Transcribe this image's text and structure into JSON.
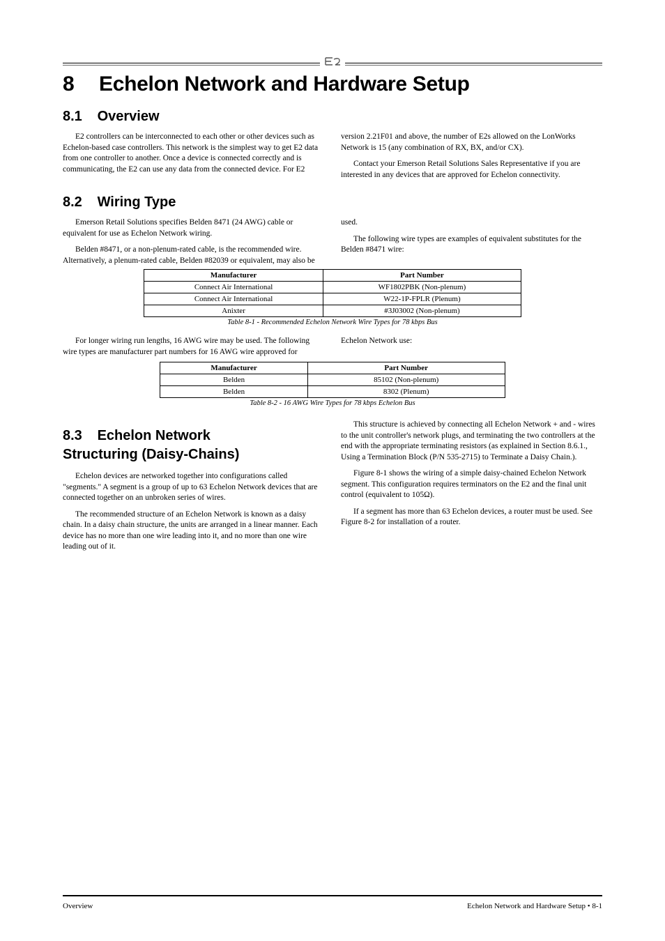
{
  "header": {
    "icon_name": "e2-logo"
  },
  "chapter": {
    "number": "8",
    "title": "Echelon Network and Hardware Setup"
  },
  "sections": {
    "s1": {
      "number": "8.1",
      "title": "Overview",
      "p1": "E2 controllers can be interconnected to each other or other devices such as Echelon-based case controllers. This network is the simplest way to get E2 data from one controller to another. Once a device is connected correctly and is communicating, the E2 can use any data from the connected device. For E2 version 2.21F01 and above, the number of E2s allowed on the LonWorks Network is 15 (any combination of RX, BX, and/or CX).",
      "p2": "Contact your Emerson Retail Solutions Sales Representative if you are interested in any devices that are approved for Echelon connectivity."
    },
    "s2": {
      "number": "8.2",
      "title": "Wiring Type",
      "p1": "Emerson Retail Solutions specifies Belden 8471 (24 AWG) cable or equivalent for use as Echelon Network wiring.",
      "p2": "Belden #8471, or a non-plenum-rated cable, is the recommended wire. Alternatively, a plenum-rated cable, Belden #82039 or equivalent, may also be used.",
      "p3": "The following wire types are examples of equivalent substitutes for the Belden #8471 wire:",
      "table_caption": "Table 8-1 - Recommended Echelon Network Wire Types for 78 kbps Bus",
      "p4": "For longer wiring run lengths, 16 AWG wire may be used. The following wire types are manufacturer part numbers for 16 AWG wire approved for Echelon Network use:",
      "table2_caption": "Table 8-2 - 16 AWG Wire Types for 78 kbps Echelon Bus"
    },
    "s3": {
      "number": "8.3",
      "title_line1": "Echelon Network",
      "title_line2": "Structuring (Daisy-Chains)",
      "p1": "Echelon devices are networked together into configurations called \"segments.\" A segment is a group of up to 63 Echelon Network devices that are connected together on an unbroken series of wires.",
      "p2": "The recommended structure of an Echelon Network is known as a daisy chain. In a daisy chain structure, the units are arranged in a linear manner. Each device has no more than one wire leading into it, and no more than one wire leading out of it.",
      "p3": "This structure is achieved by connecting all Echelon Network + and - wires to the unit controller's network plugs, and terminating the two controllers at the end with the appropriate terminating resistors (as explained in Section 8.6.1., Using a Termination Block (P/N 535-2715) to Terminate a Daisy Chain.).",
      "p4": "Figure 8-1 shows the wiring of a simple daisy-chained Echelon Network segment. This configuration requires terminators on the E2 and the final unit control (equivalent to 105Ω).",
      "p5": "If a segment has more than 63 Echelon devices, a router must be used. See Figure 8-2 for installation of a router."
    }
  },
  "table1": {
    "headers": [
      "Manufacturer",
      "Part Number"
    ],
    "rows": [
      [
        "Connect Air International",
        "WF1802PBK (Non-plenum)"
      ],
      [
        "Connect Air International",
        "W22-1P-FPLR (Plenum)"
      ],
      [
        "Anixter",
        "#3J03002 (Non-plenum)"
      ]
    ]
  },
  "table2": {
    "headers": [
      "Manufacturer",
      "Part Number"
    ],
    "rows": [
      [
        "Belden",
        "85102 (Non-plenum)"
      ],
      [
        "Belden",
        "8302 (Plenum)"
      ]
    ]
  },
  "footer": {
    "left": "Overview",
    "right": "Echelon Network and Hardware Setup • 8-1"
  }
}
